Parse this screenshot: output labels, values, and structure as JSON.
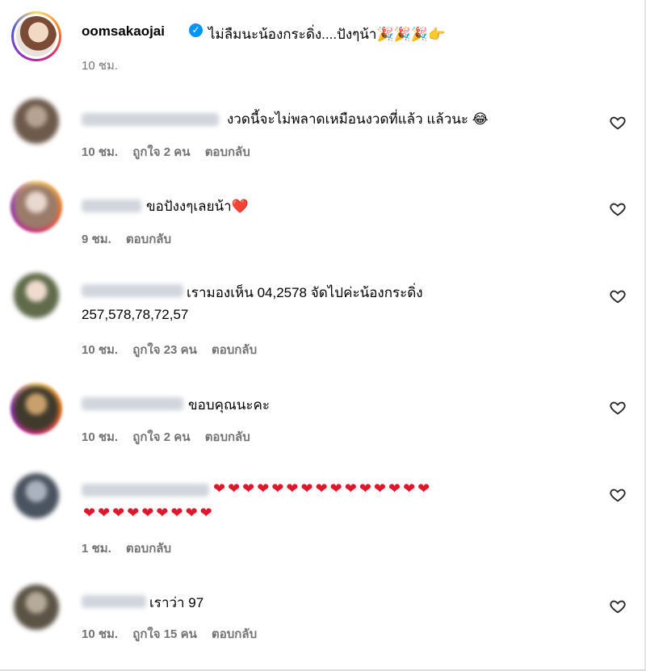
{
  "post": {
    "owner_username": "oomsakaojai",
    "caption": "ไม่ลืมนะน้องกระดิ่ง....ปังๆน้า",
    "caption_emojis": "🎉🎉🎉👉",
    "time": "10 ชม."
  },
  "comments": [
    {
      "text": "งวดนี้จะไม่พลาดเหมือนงวดที่แล้ว แล้วนะ 😂",
      "time": "10 ชม.",
      "likes": "ถูกใจ 2 คน",
      "reply": "ตอบกลับ"
    },
    {
      "text": "ขอปังงๆเลยน้า❤️",
      "time": "9 ชม.",
      "likes": "",
      "reply": "ตอบกลับ"
    },
    {
      "text": "เรามองเห็น 04,2578 จัดไปค่ะน้องกระดิ่ง",
      "text2": "257,578,78,72,57",
      "time": "10 ชม.",
      "likes": "ถูกใจ 23 คน",
      "reply": "ตอบกลับ"
    },
    {
      "text": "ขอบคุณนะคะ",
      "time": "10 ชม.",
      "likes": "ถูกใจ 2 คน",
      "reply": "ตอบกลับ"
    },
    {
      "text": "❤❤❤❤❤❤❤❤❤❤❤❤❤❤❤",
      "text2": "❤❤❤❤❤❤❤❤❤",
      "time": "1 ชม.",
      "likes": "",
      "reply": "ตอบกลับ"
    },
    {
      "text": "เราว่า 97",
      "time": "10 ชม.",
      "likes": "ถูกใจ 15 คน",
      "reply": "ตอบกลับ"
    }
  ],
  "colors": {
    "verified": "#0095f6",
    "meta_text": "#737373",
    "heart_emoji": "#e0162b"
  }
}
